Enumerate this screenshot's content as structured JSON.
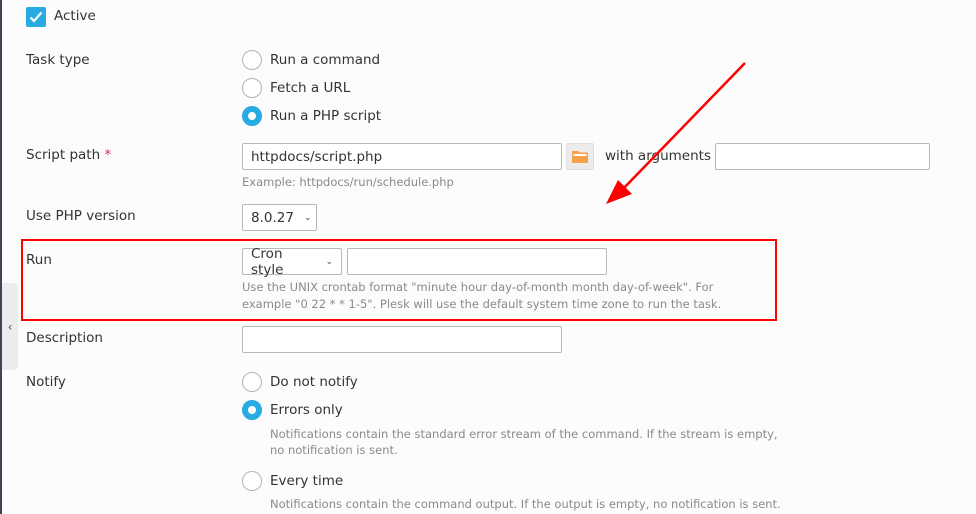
{
  "active": {
    "label": "Active",
    "checked": true
  },
  "task_type": {
    "label": "Task type",
    "options": [
      {
        "label": "Run a command",
        "selected": false
      },
      {
        "label": "Fetch a URL",
        "selected": false
      },
      {
        "label": "Run a PHP script",
        "selected": true
      }
    ]
  },
  "script_path": {
    "label": "Script path",
    "required_mark": "*",
    "value": "httpdocs/script.php",
    "hint": "Example: httpdocs/run/schedule.php",
    "browse_icon": "folder-icon",
    "arguments_label": "with arguments",
    "arguments_value": ""
  },
  "php_version": {
    "label": "Use PHP version",
    "selected": "8.0.27"
  },
  "run": {
    "label": "Run",
    "mode_selected": "Cron style",
    "cron_value": "",
    "hint_line1": "Use the UNIX crontab format \"minute hour day-of-month month day-of-week\". For",
    "hint_line2": "example \"0 22 * * 1-5\". Plesk will use the default system time zone to run the task."
  },
  "description": {
    "label": "Description",
    "value": ""
  },
  "notify": {
    "label": "Notify",
    "options": [
      {
        "label": "Do not notify",
        "selected": false,
        "hint": ""
      },
      {
        "label": "Errors only",
        "selected": true,
        "hint_line1": "Notifications contain the standard error stream of the command. If the stream is empty,",
        "hint_line2": "no notification is sent."
      },
      {
        "label": "Every time",
        "selected": false,
        "hint_line1": "Notifications contain the command output. If the output is empty, no notification is sent."
      }
    ]
  },
  "sidebar_toggle": {
    "icon": "chevron-left-icon",
    "glyph": "‹"
  },
  "colors": {
    "accent": "#28aae2",
    "annotation": "#ff0000",
    "required": "#e0245e",
    "folder": "#f7a248"
  }
}
